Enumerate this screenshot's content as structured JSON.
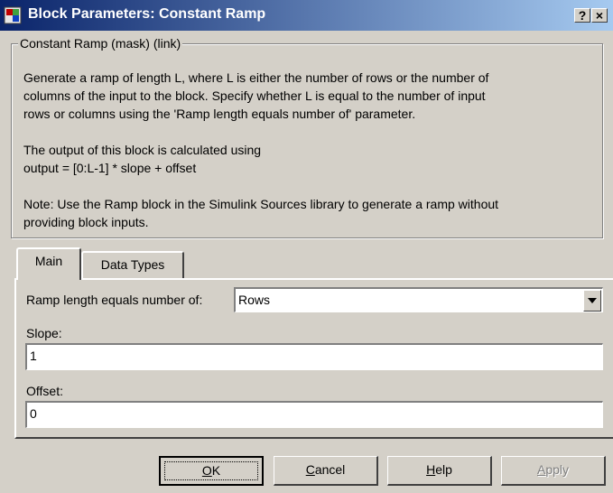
{
  "window": {
    "title": "Block Parameters: Constant Ramp",
    "help_button": "?",
    "close_button": "×",
    "app_icon": "simulink-block-icon"
  },
  "group": {
    "legend": "Constant Ramp (mask) (link)",
    "description_lines": [
      "Generate a ramp of length L, where L is either the number of rows or the number of",
      "columns of the input to the block.  Specify whether L is equal to the number of input",
      "rows or columns using the 'Ramp length equals number of' parameter.",
      "",
      "The output of this block is calculated using",
      "output = [0:L-1] * slope + offset",
      "",
      "Note: Use the Ramp block in the Simulink Sources library to generate a ramp without",
      "providing block inputs."
    ]
  },
  "tabs": [
    {
      "label": "Main",
      "active": true
    },
    {
      "label": "Data Types",
      "active": false
    }
  ],
  "main": {
    "ramp_length_label": "Ramp length equals number of:",
    "ramp_length_value": "Rows",
    "slope_label": "Slope:",
    "slope_value": "1",
    "offset_label": "Offset:",
    "offset_value": "0"
  },
  "buttons": {
    "ok": {
      "label": "OK",
      "mnemonic": "O",
      "rest": "K"
    },
    "cancel": {
      "label": "Cancel",
      "mnemonic": "C",
      "rest": "ancel"
    },
    "help": {
      "label": "Help",
      "mnemonic": "H",
      "rest": "elp"
    },
    "apply": {
      "label": "Apply",
      "mnemonic": "A",
      "rest": "pply",
      "disabled": true
    }
  },
  "colors": {
    "titlebar_start": "#0a246a",
    "titlebar_end": "#a6caf0",
    "face": "#d4d0c8"
  }
}
